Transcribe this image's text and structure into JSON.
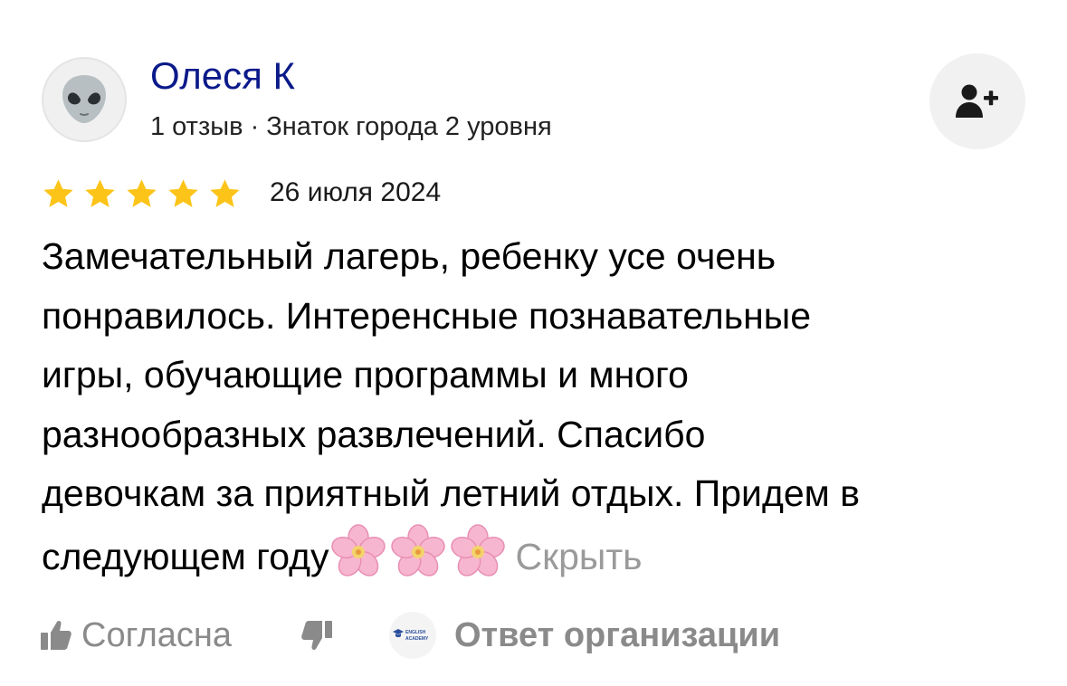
{
  "author": {
    "name": "Олеся К",
    "meta": "1 отзыв · Знаток города 2 уровня",
    "avatar_icon": "alien-icon",
    "subscribe_icon": "user-plus-icon"
  },
  "rating": {
    "stars": 5,
    "max": 5,
    "star_color": "#fcc419"
  },
  "review": {
    "date": "26 июля 2024",
    "lines": [
      "Замечательный лагерь, ребенку усе очень",
      "понравилось. Интеренсные познавательные",
      "игры, обучающие программы и много",
      "разнообразных развлечений. Спасибо",
      "девочкам за приятный летний отдых. Придем в",
      "следующем году"
    ],
    "emoji_icon": "cherry-blossom-icon",
    "emoji_count": 3,
    "hide_label": "Скрыть"
  },
  "actions": {
    "like_label": "Согласна",
    "like_icon": "thumbs-up-icon",
    "dislike_icon": "thumbs-down-icon",
    "org_logo_text": [
      "ENGLISH",
      "ACADEMY"
    ],
    "org_reply_label": "Ответ организации"
  },
  "colors": {
    "author_name": "#0b1a8a",
    "muted": "#8a8a8a",
    "link_muted": "#9a9a9a"
  }
}
